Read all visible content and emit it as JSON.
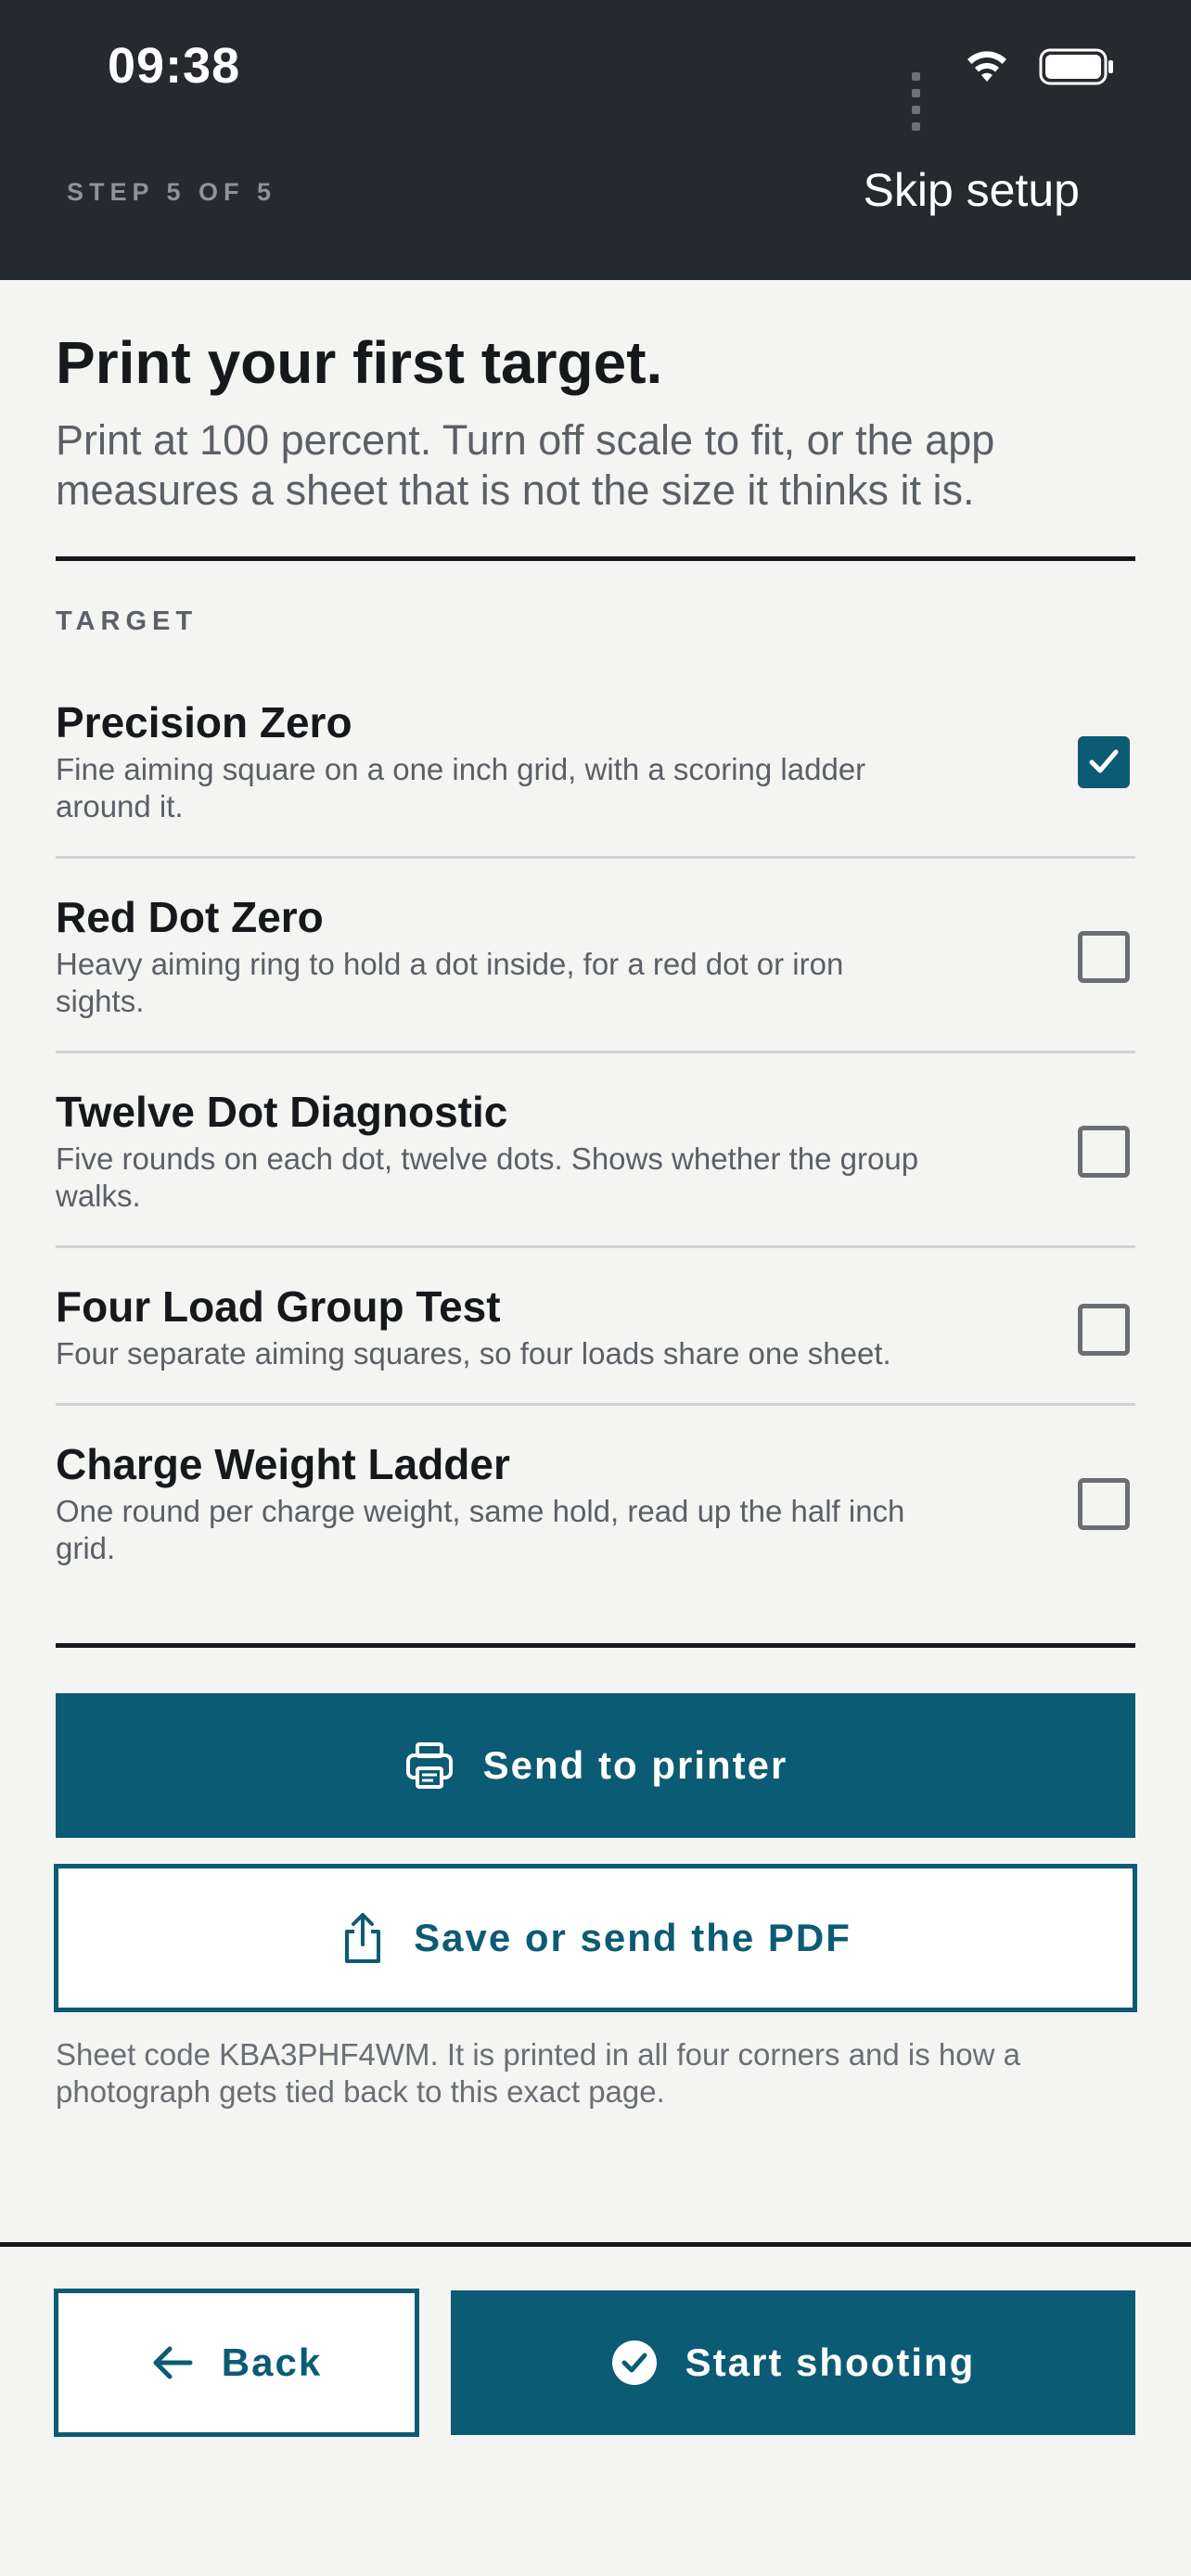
{
  "status_bar": {
    "time": "09:38"
  },
  "header": {
    "step_label": "STEP 5 OF 5",
    "skip_label": "Skip setup"
  },
  "intro": {
    "title": "Print your first target.",
    "subtitle": "Print at 100 percent. Turn off scale to fit, or the app measures a sheet that is not the size it thinks it is."
  },
  "targets": {
    "section_label": "TARGET",
    "items": [
      {
        "title": "Precision Zero",
        "description": "Fine aiming square on a one inch grid, with a scoring ladder around it.",
        "checked": true
      },
      {
        "title": "Red Dot Zero",
        "description": "Heavy aiming ring to hold a dot inside, for a red dot or iron sights.",
        "checked": false
      },
      {
        "title": "Twelve Dot Diagnostic",
        "description": "Five rounds on each dot, twelve dots. Shows whether the group walks.",
        "checked": false
      },
      {
        "title": "Four Load Group Test",
        "description": "Four separate aiming squares, so four loads share one sheet.",
        "checked": false
      },
      {
        "title": "Charge Weight Ladder",
        "description": "One round per charge weight, same hold, read up the half inch grid.",
        "checked": false
      }
    ]
  },
  "actions": {
    "print_label": "Send to printer",
    "print_icon": "printer-icon",
    "pdf_label": "Save or send the PDF",
    "pdf_icon": "share-icon"
  },
  "sheet_note": "Sheet code KBA3PHF4WM. It is printed in all four corners and is how a photograph gets tied back to this exact page.",
  "footer": {
    "back_label": "Back",
    "back_icon": "arrow-left-icon",
    "start_label": "Start shooting",
    "start_icon": "check-circle-icon"
  },
  "colors": {
    "accent": "#0c5b74",
    "header_bg": "#262a2f",
    "page_bg": "#f4f4f2",
    "text_primary": "#16191c",
    "text_secondary": "#5b6067"
  }
}
